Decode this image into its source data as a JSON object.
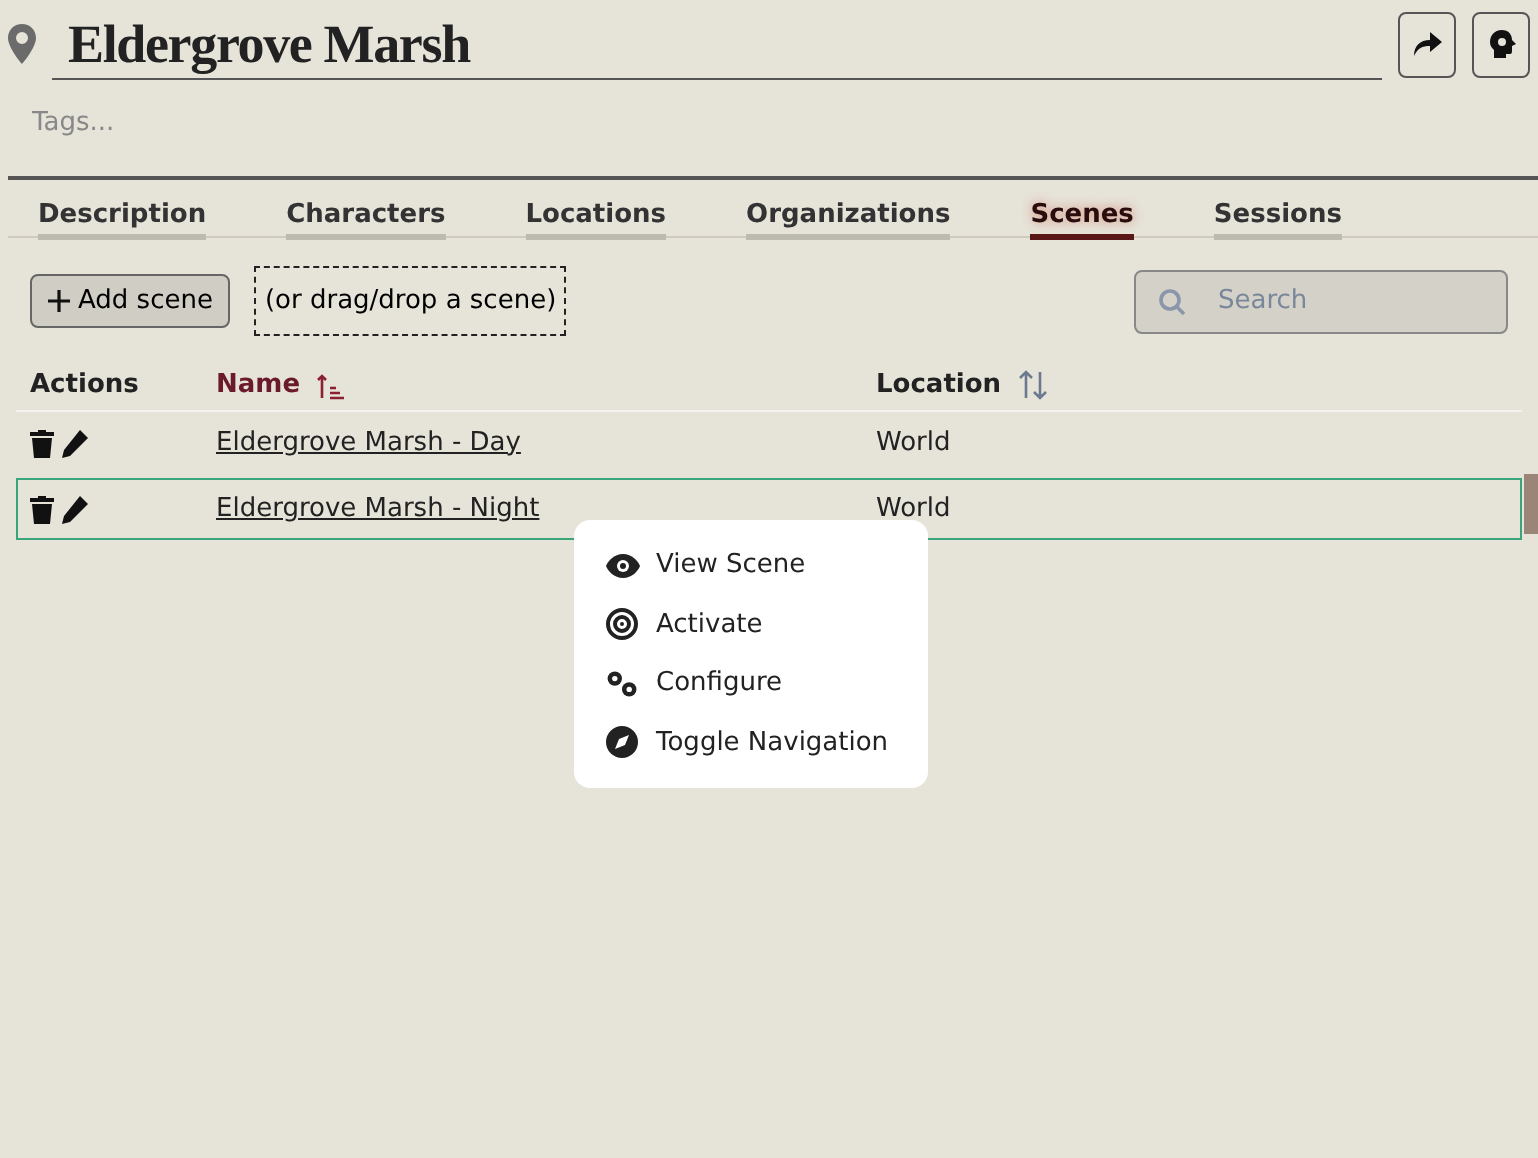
{
  "header": {
    "title": "Eldergrove Marsh",
    "tags_placeholder": "Tags..."
  },
  "tabs": [
    {
      "label": "Description",
      "selected": false
    },
    {
      "label": "Characters",
      "selected": false
    },
    {
      "label": "Locations",
      "selected": false
    },
    {
      "label": "Organizations",
      "selected": false
    },
    {
      "label": "Scenes",
      "selected": true
    },
    {
      "label": "Sessions",
      "selected": false
    }
  ],
  "toolbar": {
    "add_label": "Add scene",
    "drop_hint": "(or drag/drop a scene)",
    "search_placeholder": "Search"
  },
  "table": {
    "columns": [
      {
        "label": "Actions",
        "kind": "plain",
        "active": false
      },
      {
        "label": "Name",
        "kind": "ascending",
        "active": true
      },
      {
        "label": "Location",
        "kind": "sortable",
        "active": false
      }
    ],
    "rows": [
      {
        "name": "Eldergrove Marsh - Day",
        "location": "World",
        "selected": false
      },
      {
        "name": "Eldergrove Marsh - Night",
        "location": "World",
        "selected": true
      }
    ]
  },
  "context_menu": {
    "items": [
      {
        "kind": "eye",
        "label": "View Scene"
      },
      {
        "kind": "target",
        "label": "Activate"
      },
      {
        "kind": "gears",
        "label": "Configure"
      },
      {
        "kind": "compass",
        "label": "Toggle Navigation"
      }
    ]
  }
}
